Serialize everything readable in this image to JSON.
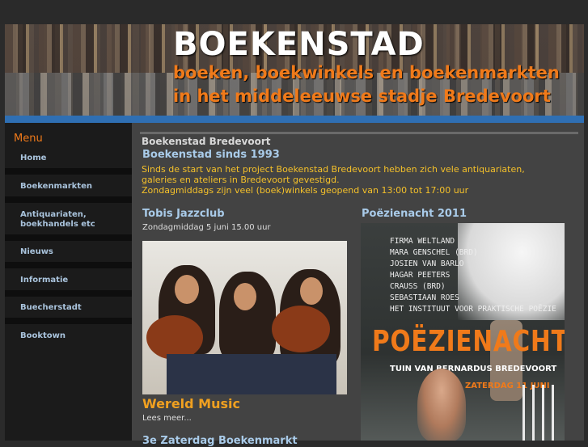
{
  "banner": {
    "title": "BOEKENSTAD",
    "subtitle_line1": "boeken, boekwinkels en boekenmarkten",
    "subtitle_line2": "in het  middeleeuwse stadje  Bredevoort"
  },
  "sidebar": {
    "menu_title": "Menu",
    "items": [
      {
        "label": "Home"
      },
      {
        "label": "Boekenmarkten"
      },
      {
        "label": "Antiquariaten, boekhandels etc"
      },
      {
        "label": "Nieuws"
      },
      {
        "label": "Informatie"
      },
      {
        "label": "Buecherstadt"
      },
      {
        "label": "Booktown"
      }
    ]
  },
  "main": {
    "breadcrumb": "Boekenstad Bredevoort",
    "heading": "Boekenstad sinds 1993",
    "intro": [
      "Sinds de start van het project Boekenstad Bredevoort hebben zich vele antiquariaten,",
      "galeries en ateliers in Bredevoort gevestigd.",
      "Zondagmiddags zijn veel (boek)winkels geopend van 13:00 tot 17:00 uur"
    ],
    "article1": {
      "title": "Tobis Jazzclub",
      "date": "Zondagmiddag 5 juni 15.00 uur",
      "feature": "Wereld Music",
      "read_more": "Lees meer..."
    },
    "article2": {
      "title": "Poëzienacht 2011",
      "poster_names": [
        "FIRMA WELTLAND",
        "MARA GENSCHEL (BRD)",
        "JOSIEN VAN BARLO",
        "HAGAR PEETERS",
        "CRAUSS (BRD)",
        "SEBASTIAAN ROES",
        "HET INSTITUUT VOOR PRAKTISCHE POËZIE"
      ],
      "poster_title": "POËZIENACHT",
      "poster_venue": "TUIN VAN BERNARDUS BREDEVOORT",
      "poster_date": "ZATERDAG 11 JUNI"
    },
    "next_heading": "3e Zaterdag Boekenmarkt"
  },
  "colors": {
    "accent_orange": "#f07a1a",
    "link_blue": "#a9c3dc",
    "banner_bar": "#2f6fb3",
    "intro_text": "#f4c02a"
  }
}
